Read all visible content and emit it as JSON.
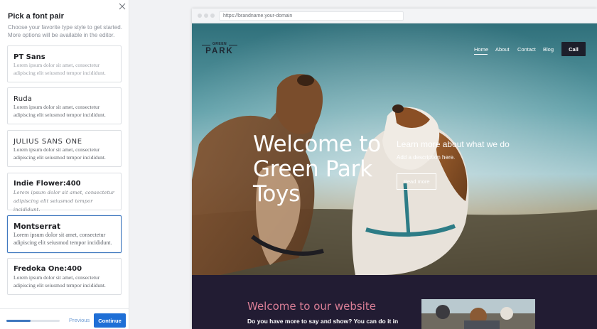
{
  "panel": {
    "title": "Pick a font pair",
    "subtitle": "Choose your favorite type style to get started. More options will be available in the editor.",
    "close_icon": "close-icon",
    "fonts": [
      {
        "name": "PT Sans",
        "sample": "Lorem ipsum dolor sit amet, consectetur adipiscing elit seiusmod tempor incididunt."
      },
      {
        "name": "Ruda",
        "sample": "Lorem ipsum dolor sit amet, consectetur adipiscing elit seiusmod tempor incididunt."
      },
      {
        "name": "JULIUS SANS ONE",
        "sample": "Lorem ipsum dolor sit amet, consectetur adipiscing elit seiusmod tempor incididunt."
      },
      {
        "name": "Indie Flower:400",
        "sample": "Lorem ipsum dolor sit amet, consectetur adipiscing elit seiusmod tempor incididunt."
      },
      {
        "name": "Montserrat",
        "sample": "Lorem ipsum dolor sit amet, consectetur adipiscing elit seiusmod tempor incididunt.",
        "selected": true
      },
      {
        "name": "Fredoka One:400",
        "sample": "Lorem ipsum dolor sit amet, consectetur adipiscing elit seiusmod tempor incididunt."
      }
    ],
    "progress_fraction": 0.45,
    "previous_label": "Previous",
    "continue_label": "Continue",
    "accent_color": "#1f6fd6"
  },
  "browser": {
    "url": "https://brandname.your-domain",
    "logo_small": "GREEN",
    "logo_big": "PARK",
    "nav": [
      "Home",
      "About",
      "Contact",
      "Blog"
    ],
    "cta": "Call",
    "hero_title": "Welcome to Green Park Toys",
    "hero_subtitle": "Learn more about what we do",
    "hero_description": "Add a description here.",
    "hero_button": "Read more",
    "section_title": "Welcome to our website",
    "section_text": "Do you have more to say and show? You can do it in",
    "section_title_color": "#d97e96",
    "section_bg_color": "#221c33"
  }
}
